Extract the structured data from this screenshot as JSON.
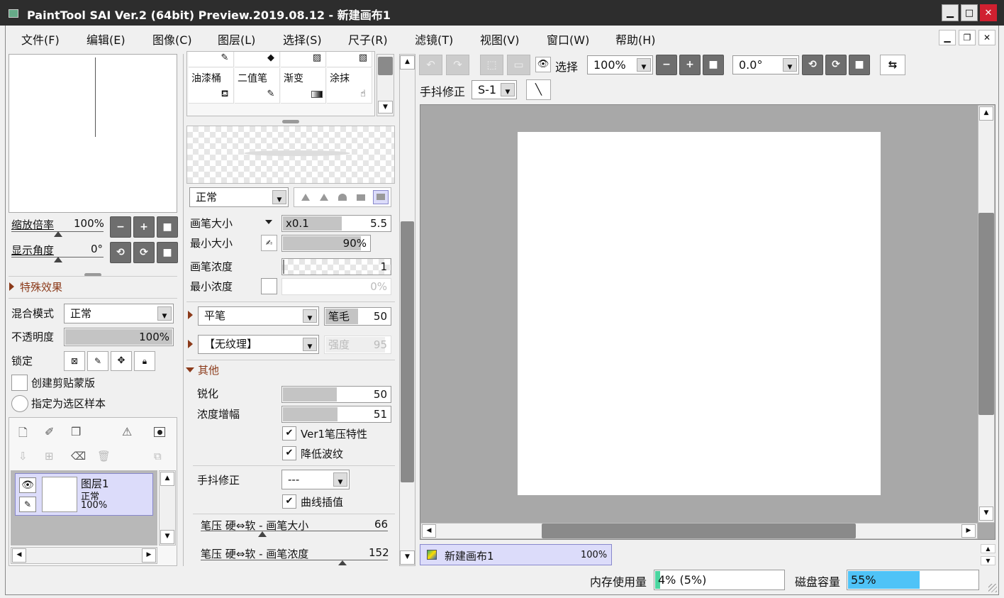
{
  "window": {
    "title": "PaintTool SAI Ver.2 (64bit) Preview.2019.08.12 - 新建画布1"
  },
  "menu": [
    "文件(F)",
    "编辑(E)",
    "图像(C)",
    "图层(L)",
    "选择(S)",
    "尺子(R)",
    "滤镜(T)",
    "视图(V)",
    "窗口(W)",
    "帮助(H)"
  ],
  "navigator": {
    "zoom_label": "缩放倍率",
    "zoom_value": "100%",
    "angle_label": "显示角度",
    "angle_value": "0°"
  },
  "layer_props": {
    "effects_label": "特殊效果",
    "blend_label": "混合模式",
    "blend_value": "正常",
    "opacity_label": "不透明度",
    "opacity_value": "100%",
    "opacity_fraction": 1.0,
    "lock_label": "锁定",
    "clip_label": "创建剪贴蒙版",
    "sample_label": "指定为选区样本"
  },
  "layers": [
    {
      "name": "图层1",
      "mode": "正常",
      "opacity": "100%"
    }
  ],
  "tools": [
    {
      "name": "油漆桶",
      "icon": "bucket-icon"
    },
    {
      "name": "二值笔",
      "icon": "binary-pen-icon"
    },
    {
      "name": "渐变",
      "icon": "gradient-icon"
    },
    {
      "name": "涂抹",
      "icon": "smudge-icon"
    }
  ],
  "brush": {
    "shape_value": "正常",
    "size_label": "画笔大小",
    "size_mult": "x0.1",
    "size_value": "5.5",
    "size_fraction": 0.55,
    "min_size_label": "最小大小",
    "min_size_value": "90%",
    "min_size_fraction": 0.9,
    "density_label": "画笔浓度",
    "density_value": "1",
    "density_fraction": 0.01,
    "min_density_label": "最小浓度",
    "min_density_value": "0%",
    "brush_type": "平笔",
    "bristle_label": "笔毛",
    "bristle_value": "50",
    "bristle_fraction": 0.5,
    "texture": "【无纹理】",
    "strength_label": "强度",
    "strength_value": "95",
    "other_label": "其他",
    "sharpen_label": "锐化",
    "sharpen_value": "50",
    "sharpen_fraction": 0.5,
    "boost_label": "浓度增幅",
    "boost_value": "51",
    "boost_fraction": 0.51,
    "ver1_label": "Ver1笔压特性",
    "reduce_label": "降低波纹",
    "stab_label": "手抖修正",
    "stab_value": "---",
    "curve_label": "曲线插值",
    "pressure_size_label": "笔压 硬⇔软 - 画笔大小",
    "pressure_size_value": "66",
    "pressure_density_label": "笔压 硬⇔软 - 画笔浓度",
    "pressure_density_value": "152"
  },
  "toolbar": {
    "select_label": "选择",
    "zoom_value": "100%",
    "angle_value": "0.0°",
    "stab_label": "手抖修正",
    "stab_value": "S-1"
  },
  "canvas_tab": {
    "name": "新建画布1",
    "zoom": "100%"
  },
  "status": {
    "mem_label": "内存使用量",
    "mem_value": "4% (5%)",
    "mem_fraction": 0.04,
    "disk_label": "磁盘容量",
    "disk_value": "55%",
    "disk_fraction": 0.55
  },
  "colors": {
    "accent": "#4fc3f7",
    "mem": "#4bd6a0",
    "title_bg": "#2d2d2d",
    "close": "#d02030",
    "section": "#8b3a1a",
    "layer_sel": "#dcdcfa"
  }
}
